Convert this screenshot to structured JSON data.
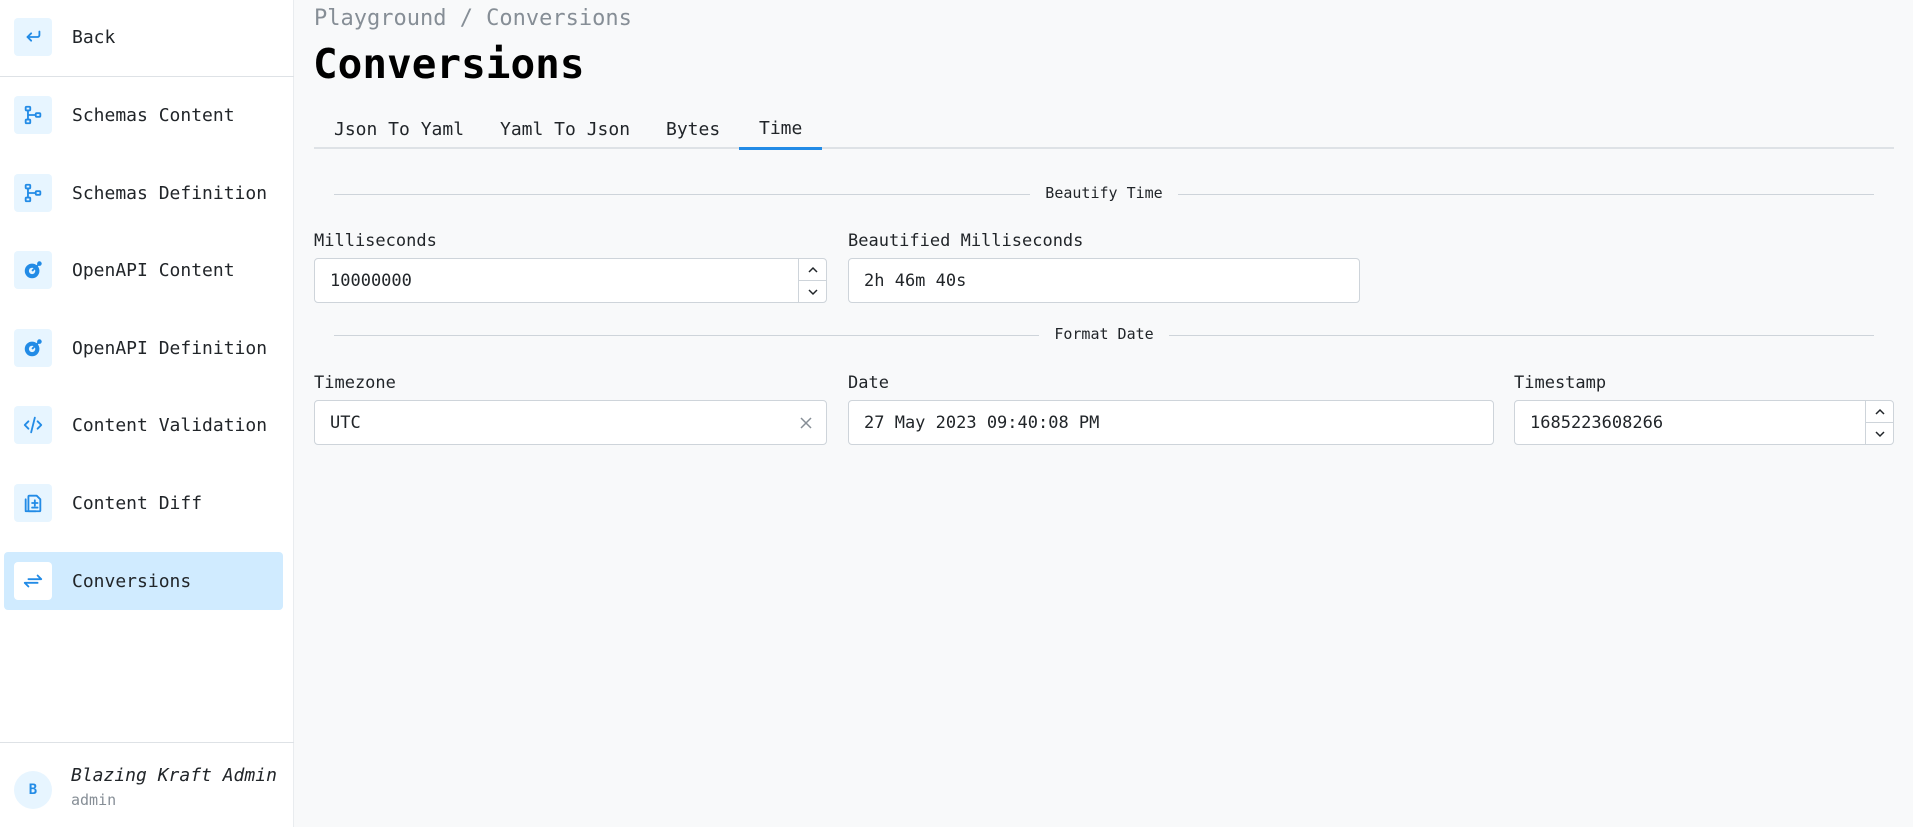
{
  "sidebar": {
    "back_label": "Back",
    "items": [
      {
        "label": "Schemas Content",
        "icon": "schema-icon"
      },
      {
        "label": "Schemas Definition",
        "icon": "schema-icon"
      },
      {
        "label": "OpenAPI Content",
        "icon": "openapi-icon"
      },
      {
        "label": "OpenAPI Definition",
        "icon": "openapi-icon"
      },
      {
        "label": "Content Validation",
        "icon": "code-icon"
      },
      {
        "label": "Content Diff",
        "icon": "diff-icon"
      },
      {
        "label": "Conversions",
        "icon": "arrows-exchange-icon"
      }
    ],
    "active_index": 6
  },
  "user": {
    "initial": "B",
    "name": "Blazing Kraft Admin",
    "role": "admin"
  },
  "breadcrumb": "Playground / Conversions",
  "page_title": "Conversions",
  "tabs": [
    {
      "label": "Json To Yaml"
    },
    {
      "label": "Yaml To Json"
    },
    {
      "label": "Bytes"
    },
    {
      "label": "Time"
    }
  ],
  "active_tab": "Time",
  "beautify": {
    "section_label": "Beautify Time",
    "ms_label": "Milliseconds",
    "ms_value": "10000000",
    "beautified_label": "Beautified Milliseconds",
    "beautified_value": "2h 46m 40s"
  },
  "format_date": {
    "section_label": "Format Date",
    "timezone_label": "Timezone",
    "timezone_value": "UTC",
    "date_label": "Date",
    "date_value": "27 May 2023 09:40:08 PM",
    "timestamp_label": "Timestamp",
    "timestamp_value": "1685223608266"
  },
  "colors": {
    "accent": "#228be6",
    "active_bg": "#d0ebff",
    "icon_bg": "#e7f5ff"
  }
}
